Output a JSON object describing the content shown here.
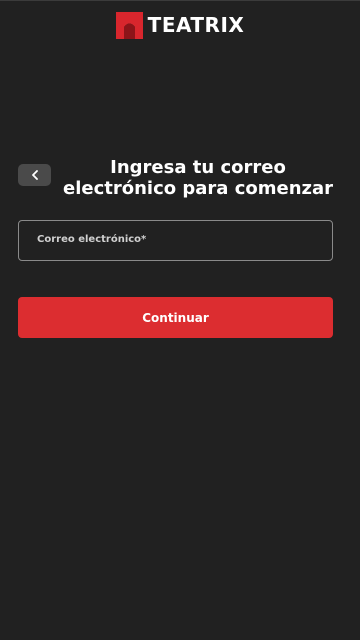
{
  "brand": {
    "name": "TEATRIX",
    "logo_icon": "teatrix-logo-icon",
    "accent_color": "#d8262d"
  },
  "header": {
    "back_icon": "chevron-left-icon",
    "title": "Ingresa tu correo electrónico para comenzar"
  },
  "form": {
    "email_label": "Correo electrónico*",
    "email_value": ""
  },
  "actions": {
    "continue_label": "Continuar",
    "button_color": "#dc2d30"
  },
  "theme": {
    "background": "#212121"
  }
}
